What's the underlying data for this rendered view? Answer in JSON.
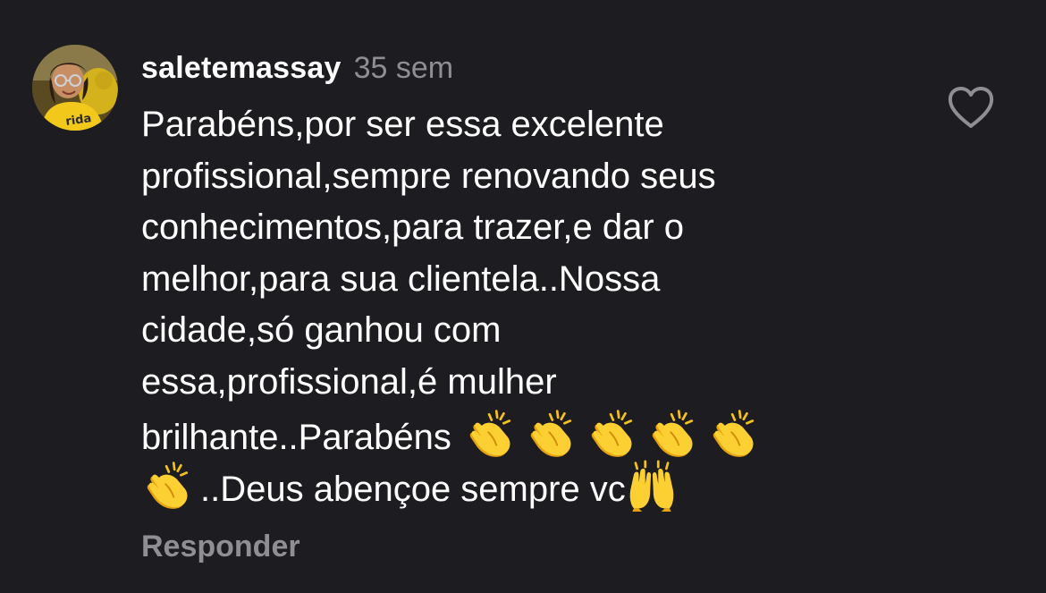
{
  "comment": {
    "username": "saletemassay",
    "time": "35 sem",
    "lines": [
      "Parabéns,por ser essa excelente",
      "profissional,sempre renovando seus",
      "conhecimentos,para trazer,e dar o",
      "melhor,para sua clientela..Nossa",
      "cidade,só ganhou com",
      "essa,profissional,é mulher",
      "brilhante..Parabéns",
      "..Deus abençoe sempre vc"
    ],
    "reply_label": "Responder",
    "like_icon": "heart-outline-icon",
    "emojis": [
      "clapping-hands",
      "raising-hands"
    ]
  },
  "colors": {
    "background": "#1c1c21",
    "text": "#ffffff",
    "muted": "#8e8e93",
    "emoji_yellow": "#f9c22e"
  }
}
